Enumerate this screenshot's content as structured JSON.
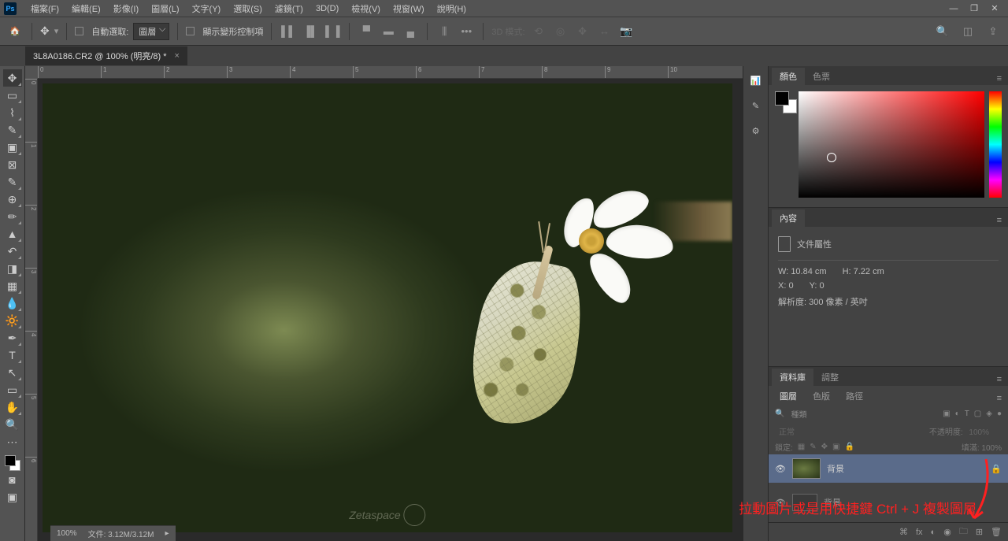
{
  "menubar": {
    "items": [
      "檔案(F)",
      "編輯(E)",
      "影像(I)",
      "圖層(L)",
      "文字(Y)",
      "選取(S)",
      "濾鏡(T)",
      "3D(D)",
      "檢視(V)",
      "視窗(W)",
      "說明(H)"
    ]
  },
  "optbar": {
    "auto_select": "自動選取:",
    "layer_dd": "圖層",
    "show_transform": "顯示變形控制項",
    "mode3d": "3D 模式:"
  },
  "doc": {
    "tab": "3L8A0186.CR2 @ 100% (明亮/8) *"
  },
  "status": {
    "zoom": "100%",
    "file": "文件: 3.12M/3.12M"
  },
  "panels": {
    "color_tab": "顏色",
    "swatches_tab": "色票",
    "props_tab": "內容",
    "props_title": "文件屬性",
    "w_lbl": "W:",
    "w_val": "10.84 cm",
    "h_lbl": "H:",
    "h_val": "7.22 cm",
    "x_lbl": "X:",
    "x_val": "0",
    "y_lbl": "Y:",
    "y_val": "0",
    "res": "解析度: 300 像素 / 英吋",
    "lib_tab": "資料庫",
    "adj_tab": "調整",
    "layers_tab": "圖層",
    "chan_tab": "色版",
    "paths_tab": "路徑",
    "kind": "種類",
    "blend": "正常",
    "opacity_lbl": "不透明度:",
    "opacity": "100%",
    "lock_lbl": "鎖定:",
    "fill_lbl": "填滿:",
    "fill": "100%",
    "layer_bg": "背景",
    "layer_bg2": "背景"
  },
  "annotation": "拉動圖片或是用快捷鍵 Ctrl + J 複製圖層",
  "watermark": "Zetaspace",
  "ruler_h": [
    "0",
    "1",
    "2",
    "3",
    "4",
    "5",
    "6",
    "7",
    "8",
    "9",
    "10"
  ],
  "ruler_v": [
    "0",
    "1",
    "2",
    "3",
    "4",
    "5",
    "6"
  ]
}
